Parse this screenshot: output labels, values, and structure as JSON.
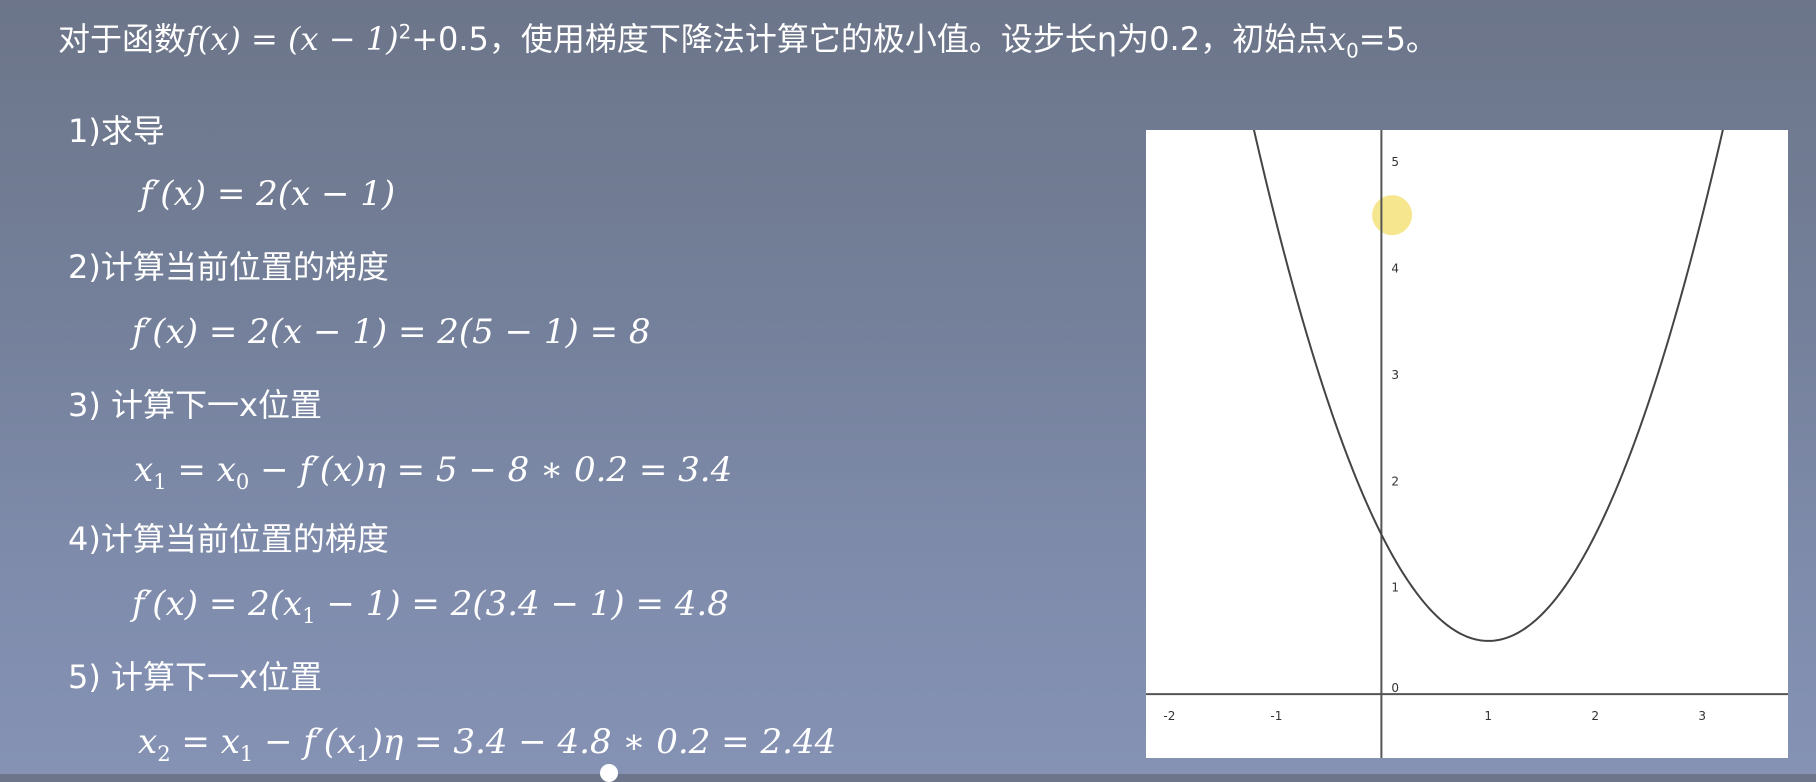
{
  "title": {
    "prefix": "对于函数",
    "func_lhs": "f(x)",
    "func_eq": " = (x − 1)",
    "func_exp": "2",
    "func_tail": "+0.5",
    "mid": "，使用梯度下降法计算它的极小值。设步长η为0.2，初始点",
    "x0_base": "x",
    "x0_sub": "0",
    "suffix": "=5。"
  },
  "steps": [
    {
      "label": "1)求导",
      "eq_html": "f′(x) = 2(x − 1)"
    },
    {
      "label": "2)计算当前位置的梯度",
      "eq_html": "f′(x) = 2(x − 1) = 2(5 − 1) = 8"
    },
    {
      "label": "3) 计算下一x位置",
      "eq_a": "x",
      "eq_a_sub": "1",
      "eq_b": " = x",
      "eq_b_sub": "0",
      "eq_c": " − f′(x)η = 5 − 8 ∗ 0.2 = 3.4"
    },
    {
      "label": "4)计算当前位置的梯度",
      "eq_a": "f′(x) = 2(x",
      "eq_a_sub": "1",
      "eq_c": " − 1) = 2(3.4 − 1) = 4.8"
    },
    {
      "label": "5) 计算下一x位置",
      "eq_a": "x",
      "eq_a_sub": "2",
      "eq_b": " = x",
      "eq_b_sub": "1",
      "eq_c": " − f′(x",
      "eq_c_sub": "1",
      "eq_d": ")η = 3.4 − 4.8 ∗ 0.2 = 2.44"
    }
  ],
  "chart_data": {
    "type": "line",
    "function": "(x - 1)^2 + 0.5",
    "xlim": [
      -2.2,
      3.8
    ],
    "ylim": [
      -0.6,
      5.3
    ],
    "x_ticks": [
      "-2",
      "-1",
      "0",
      "1",
      "2",
      "3"
    ],
    "y_ticks": [
      "0",
      "1",
      "2",
      "3",
      "4",
      "5"
    ],
    "x_tick_values": [
      -2,
      -1,
      0,
      1,
      2,
      3
    ],
    "y_tick_values": [
      0,
      1,
      2,
      3,
      4,
      5
    ],
    "highlight_point": {
      "x": 0.1,
      "y": 4.5
    },
    "colors": {
      "curve": "#444444",
      "axis": "#555555",
      "highlight": "#f5e27a"
    }
  }
}
